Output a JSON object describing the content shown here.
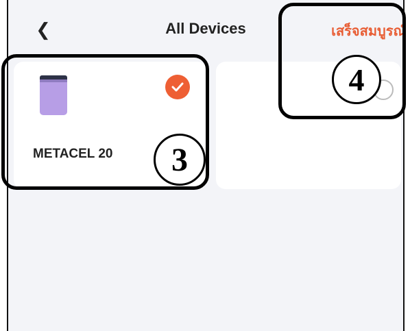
{
  "header": {
    "back_icon": "chevron-left-icon",
    "title": "All Devices",
    "done_label": "เสร็จสมบูรณ์"
  },
  "devices": [
    {
      "name": "METACEL 20",
      "selected": true,
      "image_icon": "power-station-icon"
    },
    {
      "name": "",
      "selected": false
    }
  ],
  "annotations": {
    "step3": "3",
    "step4": "4"
  },
  "colors": {
    "accent": "#e85d34",
    "background": "#f3f4f8",
    "device_purple": "#b79ee6"
  }
}
